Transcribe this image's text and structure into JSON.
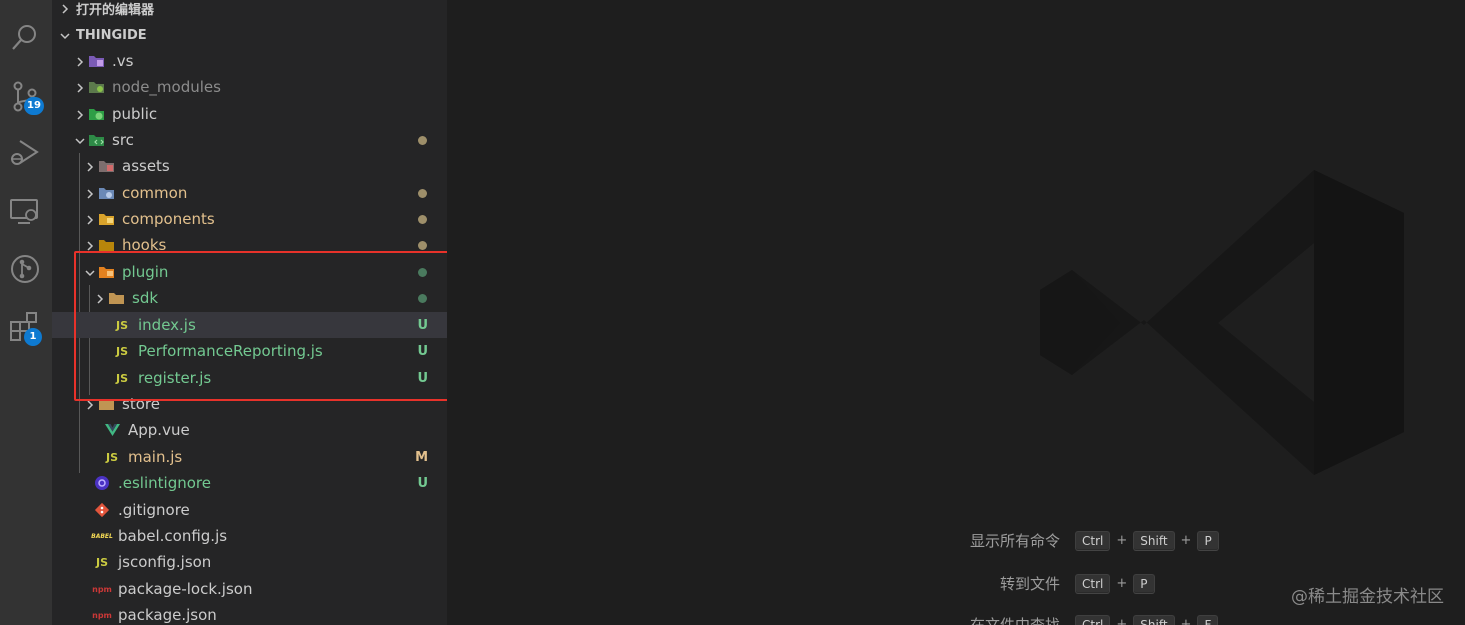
{
  "sidebar": {
    "open_editors_label": "打开的编辑器",
    "project_label": "THINGIDE",
    "tree": [
      {
        "label": ".vs",
        "status": ""
      },
      {
        "label": "node_modules",
        "status": ""
      },
      {
        "label": "public",
        "status": ""
      },
      {
        "label": "src",
        "status": ""
      },
      {
        "label": "assets",
        "status": ""
      },
      {
        "label": "common",
        "status": ""
      },
      {
        "label": "components",
        "status": ""
      },
      {
        "label": "hooks",
        "status": ""
      },
      {
        "label": "plugin",
        "status": ""
      },
      {
        "label": "sdk",
        "status": ""
      },
      {
        "label": "index.js",
        "status": "U"
      },
      {
        "label": "PerformanceReporting.js",
        "status": "U"
      },
      {
        "label": "register.js",
        "status": "U"
      },
      {
        "label": "store",
        "status": ""
      },
      {
        "label": "App.vue",
        "status": ""
      },
      {
        "label": "main.js",
        "status": "M"
      },
      {
        "label": ".eslintignore",
        "status": "U"
      },
      {
        "label": ".gitignore",
        "status": ""
      },
      {
        "label": "babel.config.js",
        "status": ""
      },
      {
        "label": "jsconfig.json",
        "status": ""
      },
      {
        "label": "package-lock.json",
        "status": ""
      },
      {
        "label": "package.json",
        "status": ""
      }
    ],
    "js_badge": "JS",
    "babel_badge": "BABEL",
    "npm_badge": "npm"
  },
  "activity_bar": {
    "items": [
      {
        "icon": "search-icon",
        "badge": ""
      },
      {
        "icon": "source-control-icon",
        "badge": "19"
      },
      {
        "icon": "run-debug-icon",
        "badge": ""
      },
      {
        "icon": "remote-explorer-icon",
        "badge": ""
      },
      {
        "icon": "git-graph-icon",
        "badge": ""
      },
      {
        "icon": "extensions-icon",
        "badge": "1"
      }
    ]
  },
  "editor": {
    "shortcuts": [
      {
        "label": "显示所有命令",
        "keys": [
          "Ctrl",
          "Shift",
          "P"
        ]
      },
      {
        "label": "转到文件",
        "keys": [
          "Ctrl",
          "P"
        ]
      },
      {
        "label": "在文件中查找",
        "keys": [
          "Ctrl",
          "Shift",
          "F"
        ]
      }
    ],
    "watermark": "@稀土掘金技术社区"
  },
  "colors": {
    "untracked": "#73c991",
    "modified": "#e2c08d",
    "highlight": "#e8322a",
    "badge": "#0e7ad1"
  }
}
